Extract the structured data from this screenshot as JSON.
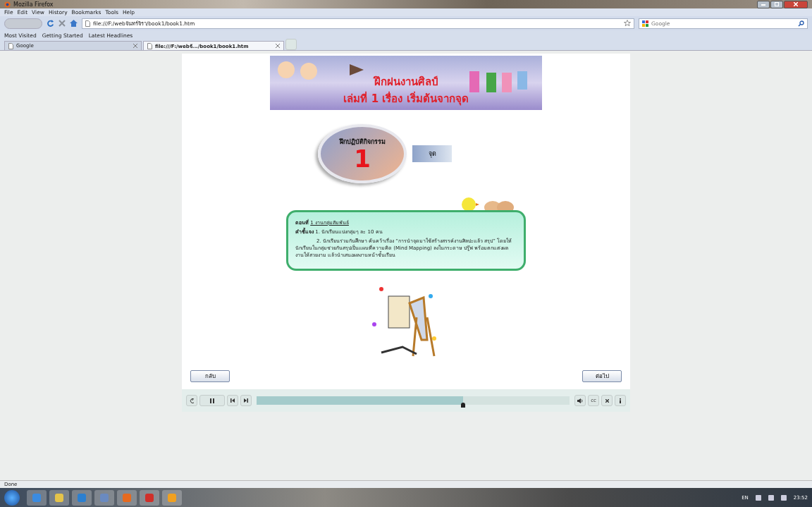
{
  "window": {
    "title": "Mozilla Firefox"
  },
  "menu": [
    "File",
    "Edit",
    "View",
    "History",
    "Bookmarks",
    "Tools",
    "Help"
  ],
  "address_bar": {
    "value": "file:///F:/webจันทร์จิรา/book1/book1.htm"
  },
  "search": {
    "placeholder": "Google"
  },
  "bookmarks": [
    "Most Visited",
    "Getting Started",
    "Latest Headlines"
  ],
  "tabs": [
    {
      "label": "Google",
      "selected": false
    },
    {
      "label": "file:///F:/webจั.../book1/book1.htm",
      "selected": true
    }
  ],
  "page": {
    "banner": {
      "title": "ฝึกฝนงานศิลป์",
      "subtitle": "เล่มที่ 1 เรื่อง เริ่มต้นจากจุด"
    },
    "activity": {
      "heading": "ฝึกปฏิบัติกิจกรรม",
      "number": "1",
      "topic": "จุด"
    },
    "instructions": [
      {
        "kind": "heading",
        "label": "ตอนที่",
        "text": "1 งานกลุ่มสัมพันธ์"
      },
      {
        "kind": "step",
        "label": "คำชี้แจง",
        "text": "1. นักเรียนแบ่งกลุ่มๆ ละ 10 คน"
      },
      {
        "kind": "para",
        "text": "2. นักเรียนร่วมกันศึกษา ค้นคว้าเรื่อง “การนำจุดมาใช้สร้างสรรค์งานศิลปะแล้ว สรุป” โดยให้นักเรียนในกลุ่มช่วยกันสรุปเป็นแผนที่ความคิด (Mind Mapping) ลงในกระดาษ ปรู๊ฟ พร้อมตกแต่งผลงานให้สวยงาม แล้วนำเสนอผลงานหน้าชั้นเรียน"
      }
    ],
    "back_button": "กลับ",
    "next_button": "ต่อไป",
    "player": {
      "level": 0.66,
      "controls": [
        "cc"
      ]
    }
  },
  "status_bar": "Done",
  "taskbar": {
    "language": "EN",
    "clock": "23:52"
  }
}
